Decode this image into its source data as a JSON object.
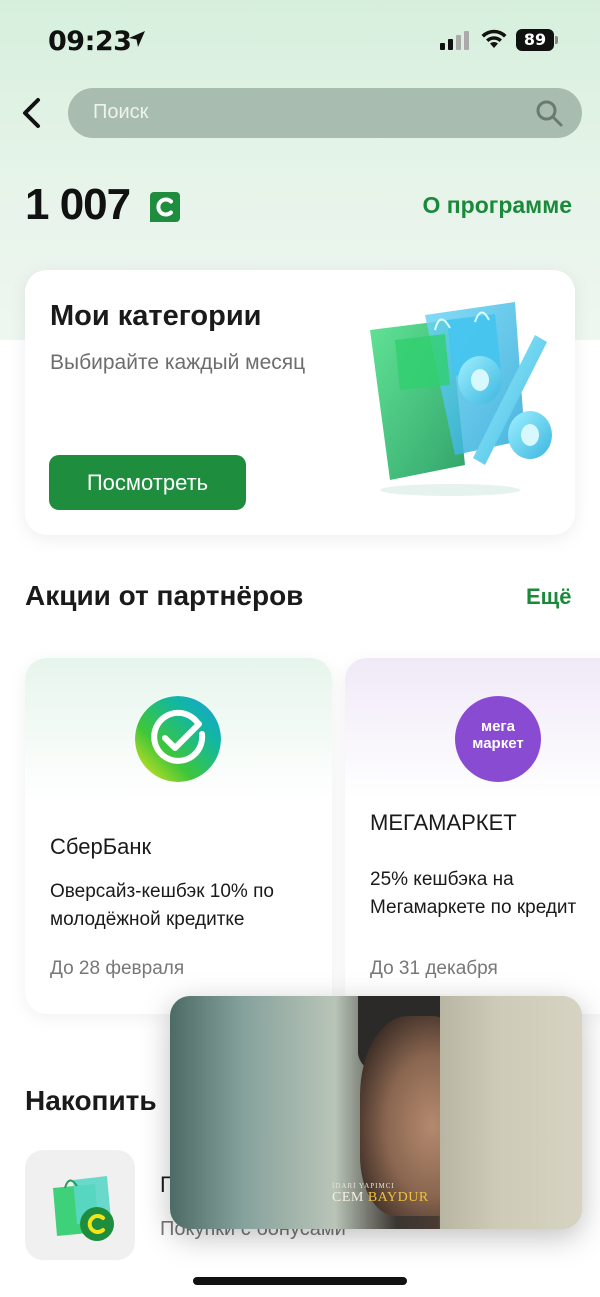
{
  "status_bar": {
    "time": "09:23",
    "battery": "89"
  },
  "header": {
    "search_placeholder": "Поиск"
  },
  "balance": {
    "amount": "1 007",
    "about_link": "О программе"
  },
  "categories_card": {
    "title": "Мои категории",
    "subtitle": "Выбирайте каждый месяц",
    "button_label": "Посмотреть"
  },
  "partners": {
    "title": "Акции от партнёров",
    "more_link": "Ещё",
    "cards": [
      {
        "name": "СберБанк",
        "description_line1": "Оверсайз-кешбэк 10% по",
        "description_line2": "молодёжной кредитке",
        "date": "До 28 февраля"
      },
      {
        "logo_text_line1": "мега",
        "logo_text_line2": "маркет",
        "name": "МЕГАМАРКЕТ",
        "description_line1": "25% кешбэка на",
        "description_line2": "Мегамаркете по кредит",
        "date": "До 31 декабря"
      }
    ]
  },
  "accumulate": {
    "title": "Накопить",
    "item_title": "П",
    "item_subtitle": "Покупки с бонусами"
  },
  "pip_video": {
    "credit_role": "İDARİ YAPIMCI",
    "credit_name_part1": "CEM ",
    "credit_name_part2": "BAYDUR"
  },
  "colors": {
    "accent_green": "#1e8e3e",
    "link_green": "#1a8a3a",
    "mega_purple": "#8a4bd3"
  }
}
